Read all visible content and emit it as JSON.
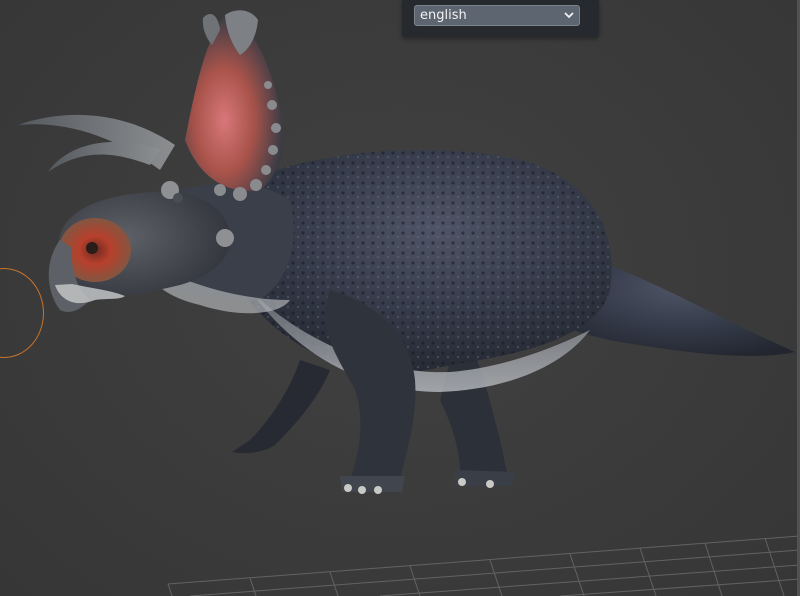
{
  "language_selector": {
    "selected": "english",
    "chevron_icon": "chevron-down-icon"
  },
  "viewport": {
    "background_color": "#3b3b3b",
    "grid_color": "#6d6d6d",
    "gizmo_color": "#c8752a"
  },
  "model": {
    "icon": "dinosaur-model"
  }
}
